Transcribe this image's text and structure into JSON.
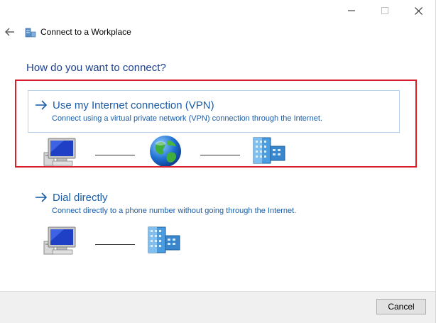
{
  "window": {
    "title": "Connect to a Workplace",
    "controls": {
      "minimize": "minimize-icon",
      "maximize": "maximize-icon",
      "close": "close-icon"
    }
  },
  "heading": "How do you want to connect?",
  "options": [
    {
      "title": "Use my Internet connection (VPN)",
      "description": "Connect using a virtual private network (VPN) connection through the Internet.",
      "selected": true,
      "diagram": [
        "computer-icon",
        "globe-icon",
        "building-icon"
      ]
    },
    {
      "title": "Dial directly",
      "description": "Connect directly to a phone number without going through the Internet.",
      "selected": false,
      "diagram": [
        "computer-icon",
        "building-icon"
      ]
    }
  ],
  "footer": {
    "cancel_label": "Cancel"
  },
  "colors": {
    "link_blue": "#1a5da8",
    "heading_blue": "#1b3f8f",
    "highlight_red": "#d8202a",
    "selection_border": "#b6d2ea",
    "footer_bg": "#f0f0f0"
  }
}
